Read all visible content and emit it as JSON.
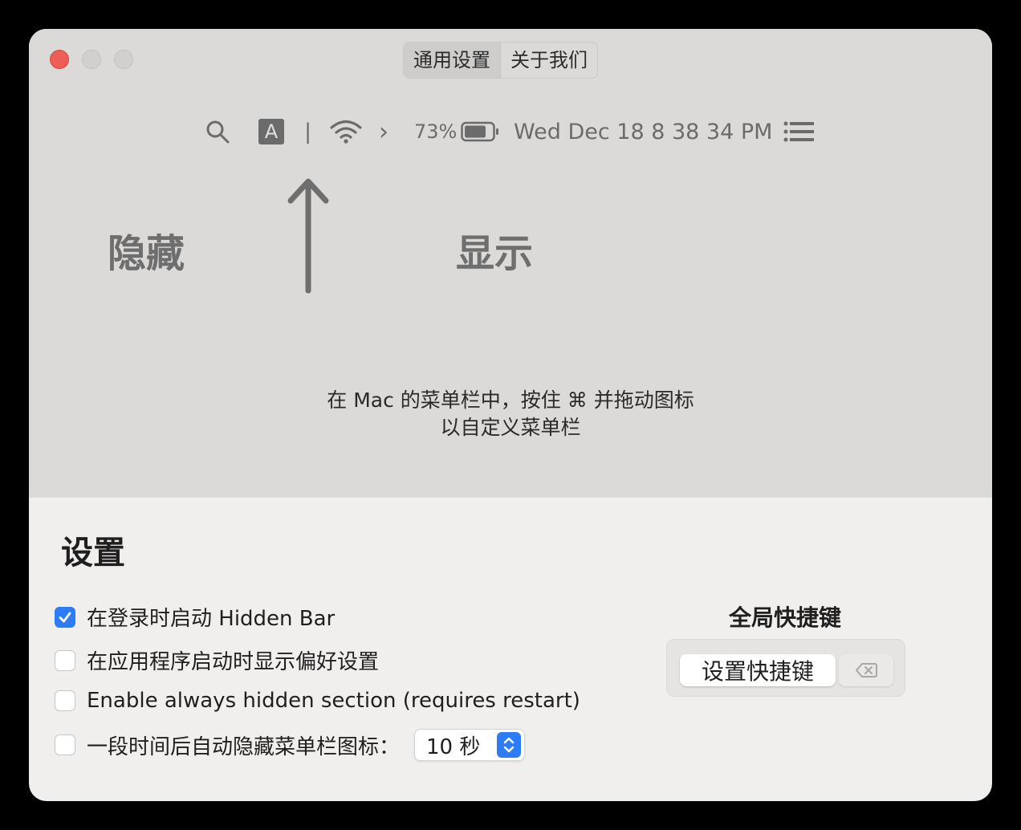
{
  "tabs": [
    {
      "label": "通用设置",
      "active": true
    },
    {
      "label": "关于我们",
      "active": false
    }
  ],
  "menubar": {
    "input_letter": "A",
    "separator": "|",
    "chevron": "›",
    "battery": "73%",
    "datetime": "Wed Dec 18  8 38 34 PM"
  },
  "labels": {
    "hide": "隐藏",
    "show": "显示"
  },
  "hint": {
    "line1": "在 Mac 的菜单栏中，按住 ⌘ 并拖动图标",
    "line2": "以自定义菜单栏"
  },
  "settings": {
    "title": "设置",
    "options": [
      {
        "label": "在登录时启动 Hidden Bar",
        "checked": true
      },
      {
        "label": "在应用程序启动时显示偏好设置",
        "checked": false
      },
      {
        "label": "Enable always hidden section (requires restart)",
        "checked": false
      },
      {
        "label": "一段时间后自动隐藏菜单栏图标：",
        "checked": false
      }
    ],
    "delay_value": "10 秒"
  },
  "shortcut": {
    "title": "全局快捷键",
    "button": "设置快捷键"
  },
  "colors": {
    "accent": "#2d7bf6",
    "close": "#ee5d56"
  }
}
